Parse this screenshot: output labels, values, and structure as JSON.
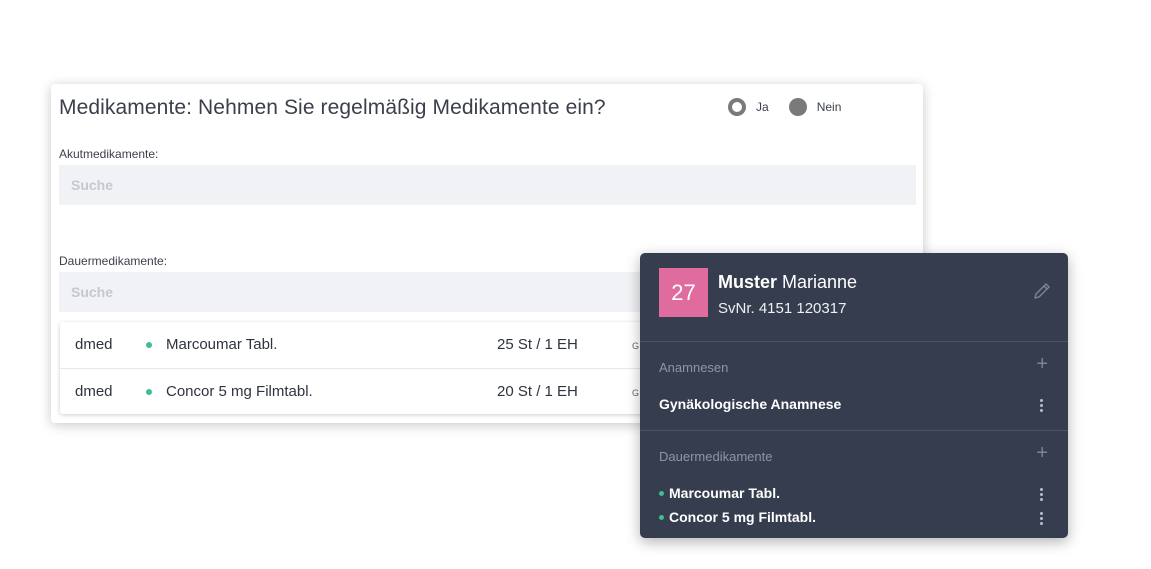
{
  "form": {
    "question": "Medikamente: Nehmen Sie regelmäßig Medikamente ein?",
    "radio_options": [
      {
        "label": "Ja",
        "selected": true
      },
      {
        "label": "Nein",
        "selected": false
      }
    ],
    "acute_label": "Akutmedikamente:",
    "acute_placeholder": "Suche",
    "permanent_label": "Dauermedikamente:",
    "permanent_placeholder": "Suche",
    "medications": [
      {
        "source": "dmed",
        "name": "Marcoumar Tabl.",
        "quantity": "25 St / 1 EH",
        "truncated": "G"
      },
      {
        "source": "dmed",
        "name": "Concor 5 mg Filmtabl.",
        "quantity": "20 St / 1 EH",
        "truncated": "G"
      }
    ]
  },
  "patient": {
    "age": "27",
    "last_name": "Muster",
    "first_name": "Marianne",
    "svnr": "SvNr. 4151  120317",
    "sections": {
      "anamnesen_title": "Anamnesen",
      "anamnesen_items": [
        "Gynäkologische Anamnese"
      ],
      "dauermed_title": "Dauermedikamente",
      "dauermed_items": [
        "Marcoumar Tabl.",
        "Concor 5 mg Filmtabl."
      ]
    }
  },
  "colors": {
    "age_badge": "#e06b9f",
    "panel_bg": "#363d4e",
    "status_dot": "#3dbf8f"
  },
  "icons": {
    "edit": "pencil-icon",
    "add": "plus-icon",
    "more": "kebab-icon"
  }
}
